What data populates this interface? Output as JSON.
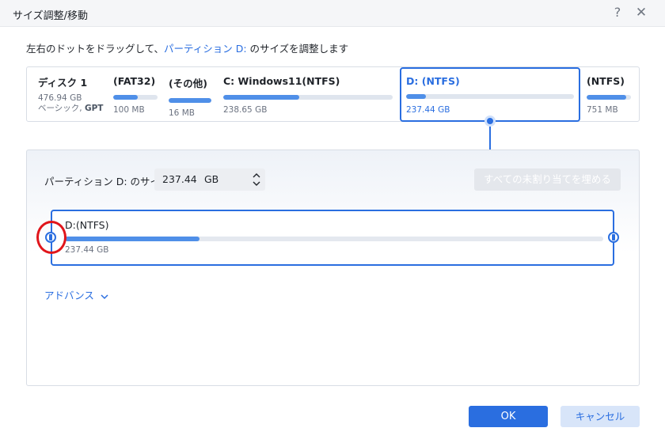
{
  "window": {
    "title": "サイズ調整/移動",
    "help_label": "?",
    "close_label": "✕"
  },
  "instruction": {
    "prefix": "左右のドットをドラッグして、",
    "partition_link": "パーティション D:",
    "suffix": " のサイズを調整します"
  },
  "disk": {
    "name": "ディスク 1",
    "capacity": "476.94 GB",
    "type_prefix": "ベーシック, ",
    "type_bold": "GPT"
  },
  "partitions": [
    {
      "name": "(FAT32)",
      "size": "100 MB",
      "fill": 0.55
    },
    {
      "name": "(その他)",
      "size": "16 MB",
      "fill": 1.0
    },
    {
      "name": "C: Windows11(NTFS)",
      "size": "238.65 GB",
      "fill": 0.45
    },
    {
      "name": "D: (NTFS)",
      "size": "237.44 GB",
      "fill": 0.12,
      "selected": true
    },
    {
      "name": "(NTFS)",
      "size": "751 MB",
      "fill": 0.9
    }
  ],
  "resize": {
    "size_label": "パーティション D: のサイズ",
    "size_value": "237.44",
    "size_unit": "GB",
    "fill_button": "すべての未割り当てを埋める",
    "partition_name": "D:(NTFS)",
    "partition_size": "237.44 GB",
    "used_fraction": 0.25
  },
  "advanced_label": "アドバンス",
  "buttons": {
    "ok": "OK",
    "cancel": "キャンセル"
  },
  "colors": {
    "accent": "#2a6ee0",
    "highlight_ring": "#e0151b"
  }
}
